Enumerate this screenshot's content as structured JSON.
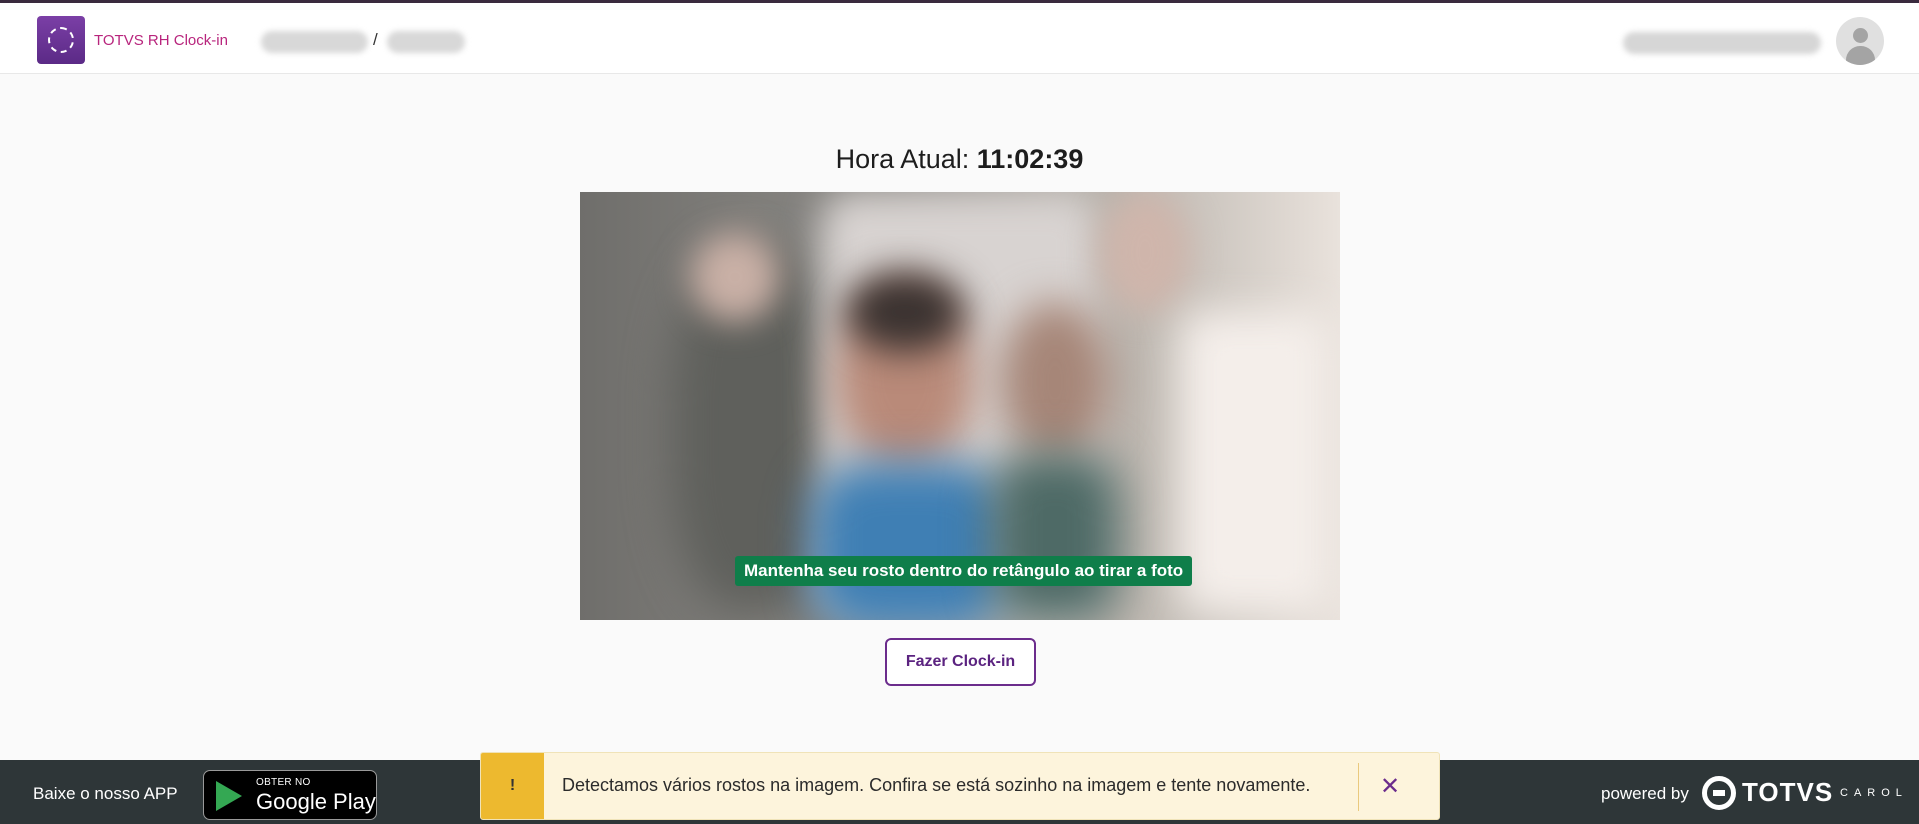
{
  "header": {
    "app_title": "TOTVS RH Clock-in",
    "breadcrumb_separator": "/"
  },
  "main": {
    "clock_label": "Hora Atual:",
    "clock_time": "11:02:39",
    "camera_hint": "Mantenha seu rosto dentro do retângulo ao tirar a foto",
    "clockin_button": "Fazer Clock-in"
  },
  "toast": {
    "icon": "!",
    "message": "Detectamos vários rostos na imagem. Confira se está sozinho na imagem e tente novamente.",
    "close": "✕"
  },
  "footer": {
    "download_text": "Baixe o nosso APP",
    "store_small": "OBTER NO",
    "store_big": "Google Play",
    "powered_by": "powered by",
    "brand": "TOTVS",
    "brand_sub": "CAROL"
  },
  "colors": {
    "accent_purple": "#6b2c8c",
    "brand_magenta": "#b8257d",
    "success_green": "#0f7e4a",
    "warning_yellow": "#edb92f",
    "footer_bg": "#2e3638"
  }
}
